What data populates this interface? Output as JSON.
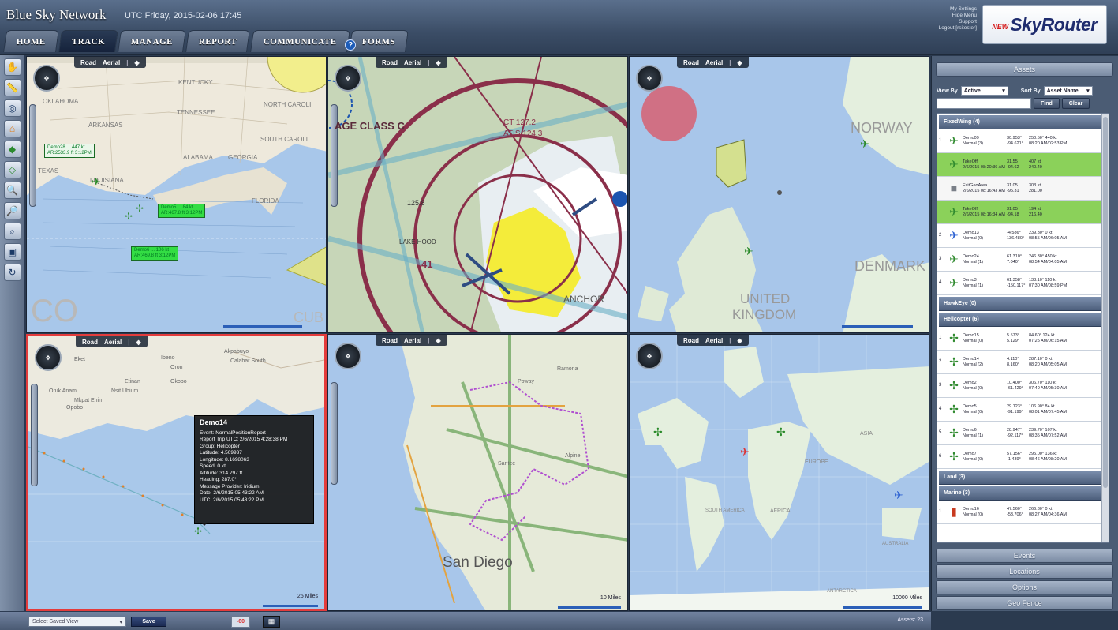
{
  "header": {
    "brand": "Blue Sky Network",
    "utc": "UTC Friday, 2015-02-06 17:45",
    "tabs": [
      "HOME",
      "TRACK",
      "MANAGE",
      "REPORT",
      "COMMUNICATE",
      "FORMS"
    ],
    "active_tab": "TRACK",
    "account_links": [
      "My Settings",
      "Hide Menu",
      "Support",
      "Logout [rsitester]"
    ],
    "logo_new": "NEW",
    "logo_main": "SkyRouter"
  },
  "toolbar": [
    "hand-icon",
    "ruler-icon",
    "globe-icon",
    "home-icon",
    "layers-icon",
    "layers2-icon",
    "zoom-icon",
    "zoom2-icon",
    "zoom3-icon",
    "screen-icon",
    "refresh-icon"
  ],
  "maps": {
    "bar": {
      "road": "Road",
      "aerial": "Aerial"
    },
    "m1": {
      "labels": [
        "KENTUCKY",
        "OKLAHOMA",
        "TENNESSEE",
        "ARKANSAS",
        "ALABAMA",
        "GEORGIA",
        "TEXAS",
        "LOUISIANA",
        "FLORIDA",
        "NORTH CAROLI",
        "SOUTH CAROLI",
        "CO",
        "CUB"
      ]
    },
    "m2": {
      "labels": [
        "AGE CLASS C",
        "LAKE HOOD",
        "ANCHOR",
        "41",
        "125.8",
        "CT 127.2",
        "ATIS 124.3"
      ]
    },
    "m3": {
      "labels": [
        "NORWAY",
        "DENMARK",
        "UNITED",
        "KINGDOM"
      ]
    },
    "m4": {
      "labels": [
        "Eket",
        "Ibeno",
        "Oron",
        "Opobo",
        "Akpabuyo",
        "Calabar South",
        "Oruk Anam",
        "Nsit Ubium",
        "Mkpat Enin",
        "Etinan",
        "Okobo"
      ],
      "tooltip": {
        "title": "Demo14",
        "lines": [
          "Event: NormalPositionReport",
          "Report Trip UTC: 2/6/2015 4:28:38 PM",
          "Group: Helicopter",
          "Latitude: 4.509937",
          "Longitude: 8.1698063",
          "Speed: 0 kt",
          "Altitude: 314.797 ft",
          "Heading: 287.0°",
          "Message Provider: Iridium",
          "Date: 2/6/2015 05:43:22 AM",
          "UTC: 2/6/2015 05:43:22 PM"
        ]
      },
      "scale": "25 Miles"
    },
    "m5": {
      "labels": [
        "San Diego",
        "Poway",
        "Ramona",
        "Alpine",
        "Santee"
      ],
      "scale": "10 Miles"
    },
    "m6": {
      "labels": [
        "EUROPE",
        "ASIA",
        "AFRICA",
        "SOUTH AMERICA",
        "AUSTRALIA",
        "ANTARCTICA"
      ],
      "scale": "10000 Miles"
    }
  },
  "panel": {
    "assets_header": "Assets",
    "view_by_label": "View By",
    "view_by_value": "Active",
    "sort_by_label": "Sort By",
    "sort_by_value": "Asset Name",
    "find_btn": "Find",
    "clear_btn": "Clear",
    "groups": [
      {
        "name": "FixedWing (4)",
        "rows": [
          {
            "num": "1",
            "icon": "plane",
            "name": "Demo09",
            "status": "Normal (3)",
            "c1": "30.953°",
            "c2": "250.50° 440 kt",
            "c3": "-94.621°",
            "c4": "08:20 AM/02:53 PM",
            "style": ""
          },
          {
            "num": "",
            "icon": "plane",
            "name": "TakeOff",
            "status": "2/6/2015 08:20:36 AM",
            "c1": "31.55",
            "c2": "407 kt",
            "c3": "-94.62",
            "c4": "240.40",
            "style": "hl"
          },
          {
            "num": "",
            "icon": "square",
            "name": "ExitGeoArea",
            "status": "2/6/2015 08:16:43 AM",
            "c1": "31.05",
            "c2": "303 kt",
            "c3": "-95.31",
            "c4": "281.00",
            "style": "hl2"
          },
          {
            "num": "",
            "icon": "plane",
            "name": "TakeOff",
            "status": "2/6/2015 08:16:34 AM",
            "c1": "31.05",
            "c2": "194 kt",
            "c3": "-94.18",
            "c4": "216.40",
            "style": "hl"
          },
          {
            "num": "2",
            "icon": "planeblue",
            "name": "Demo13",
            "status": "Normal (0)",
            "c1": "-4.586°",
            "c2": "239.30° 0 kt",
            "c3": "136.480°",
            "c4": "08:55 AM/06:05 AM",
            "style": ""
          },
          {
            "num": "3",
            "icon": "plane",
            "name": "Demo24",
            "status": "Normal (1)",
            "c1": "61.310°",
            "c2": "246.30° 450 kt",
            "c3": "7.040°",
            "c4": "08:54 AM/04:05 AM",
            "style": ""
          },
          {
            "num": "4",
            "icon": "plane",
            "name": "Demo3",
            "status": "Normal (1)",
            "c1": "61.358°",
            "c2": "133.10° 110 kt",
            "c3": "-150.117°",
            "c4": "07:30 AM/08:59 PM",
            "style": ""
          }
        ]
      },
      {
        "name": "HawkEye (0)",
        "rows": []
      },
      {
        "name": "Helicopter (6)",
        "rows": [
          {
            "num": "1",
            "icon": "heli",
            "name": "Demo15",
            "status": "Normal (0)",
            "c1": "5.573°",
            "c2": "84.60° 124 kt",
            "c3": "5.129°",
            "c4": "07:25 AM/06:15 AM",
            "style": ""
          },
          {
            "num": "2",
            "icon": "heli",
            "name": "Demo14",
            "status": "Normal (2)",
            "c1": "4.110°",
            "c2": "287.10° 0 kt",
            "c3": "8.160°",
            "c4": "08:20 AM/05:05 AM",
            "style": ""
          },
          {
            "num": "3",
            "icon": "heli",
            "name": "Demo2",
            "status": "Normal (0)",
            "c1": "10.400°",
            "c2": "306.70° 110 kt",
            "c3": "-61.429°",
            "c4": "07:40 AM/05:30 AM",
            "style": ""
          },
          {
            "num": "4",
            "icon": "heli",
            "name": "Demo5",
            "status": "Normal (0)",
            "c1": "29.123°",
            "c2": "106.90° 84 kt",
            "c3": "-91.199°",
            "c4": "08:01 AM/07:45 AM",
            "style": ""
          },
          {
            "num": "5",
            "icon": "heli",
            "name": "Demo6",
            "status": "Normal (1)",
            "c1": "28.947°",
            "c2": "239.70° 107 kt",
            "c3": "-92.117°",
            "c4": "08:35 AM/07:52 AM",
            "style": ""
          },
          {
            "num": "6",
            "icon": "heli",
            "name": "Demo7",
            "status": "Normal (0)",
            "c1": "57.156°",
            "c2": "295.00° 136 kt",
            "c3": "-1.439°",
            "c4": "08:46 AM/08:20 AM",
            "style": ""
          }
        ]
      },
      {
        "name": "Land (3)",
        "rows": []
      },
      {
        "name": "Marine (3)",
        "rows": [
          {
            "num": "1",
            "icon": "marine",
            "name": "Demo16",
            "status": "Normal (0)",
            "c1": "47.560°",
            "c2": "266.30° 0 kt",
            "c3": "-53.706°",
            "c4": "08:27 AM/04:36 AM",
            "style": ""
          }
        ]
      }
    ],
    "bottom_sections": [
      "Events",
      "Locations",
      "Options",
      "Geo Fence"
    ]
  },
  "bottom": {
    "saved_view": "Select Saved View",
    "save_btn": "Save",
    "btn1": "-60",
    "assets_count": "Assets: 23"
  }
}
